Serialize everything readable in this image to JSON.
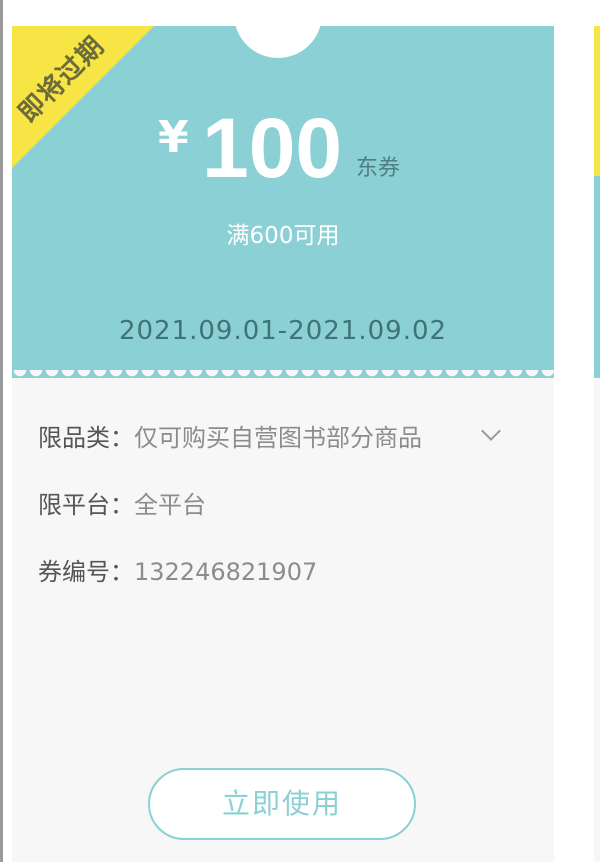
{
  "coupon": {
    "badge": "即将过期",
    "currency_symbol": "¥",
    "amount": "100",
    "unit": "东券",
    "condition": "满600可用",
    "date_range": "2021.09.01-2021.09.02",
    "details": [
      {
        "label": "限品类：",
        "value": "仅可购买自营图书部分商品",
        "expandable": true,
        "icon": "chevron-down-icon"
      },
      {
        "label": "限平台：",
        "value": "全平台"
      },
      {
        "label": "券编号：",
        "value": "132246821907"
      }
    ],
    "use_button_label": "立即使用"
  },
  "colors": {
    "coupon_top": "#8bd0d4",
    "badge": "#f6e545",
    "body": "#f7f7f7",
    "button_border": "#8bd0d4"
  }
}
